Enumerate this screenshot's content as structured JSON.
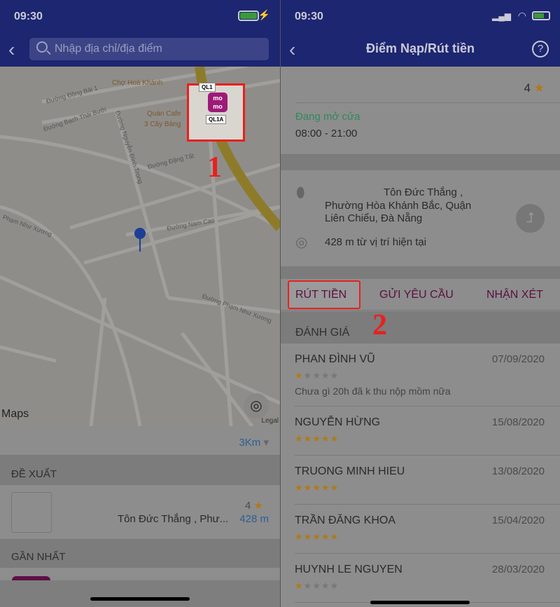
{
  "left": {
    "status": {
      "time": "09:30"
    },
    "search": {
      "placeholder": "Nhập địa chỉ/địa điểm"
    },
    "map": {
      "labels": [
        "Chợ Hoà Khánh",
        "Quán Cafe",
        "3 Cây Bàng",
        "Đường Đồng Bài 1",
        "Đường Bạch Thái Bưởi",
        "Đường Nguyễn Đình Trọng",
        "Đường Đặng Tất",
        "Đường Nam Cao",
        "Phạm Như Xương",
        "Đường Phạm Như Xương",
        "QL1",
        "QL1A"
      ],
      "attribution": "Maps",
      "legal": "Legal",
      "marker_text": "mo mo",
      "annotation": "1"
    },
    "radius": "3Km",
    "section_suggest": "ĐỀ XUẤT",
    "suggest_item": {
      "rating": "4",
      "address": "Tôn Đức Thắng  , Phư...",
      "distance": "428 m"
    },
    "section_nearest": "GẦN NHẤT"
  },
  "right": {
    "status": {
      "time": "09:30"
    },
    "nav_title": "Điểm Nạp/Rút tiền",
    "help": "?",
    "rating": "4",
    "open_status": "Đang mở cửa",
    "hours": "08:00 - 21:00",
    "address_line1": "Tôn Đức Thắng  ,",
    "address_line2": "Phường Hòa Khánh Bắc, Quận",
    "address_line3": "Liên Chiểu, Đà Nẵng",
    "distance": "428 m từ vị trí hiện tại",
    "tabs": [
      "RÚT TIỀN",
      "GỬI YÊU CẦU",
      "NHẬN XÉT"
    ],
    "annotation": "2",
    "section_reviews": "ĐÁNH GIÁ",
    "reviews": [
      {
        "name": "PHAN ĐÌNH VŨ",
        "date": "07/09/2020",
        "stars": 1,
        "comment": "Chưa gì 20h đã k thu nộp mồm nữa"
      },
      {
        "name": "NGUYỄN HỪNG",
        "date": "15/08/2020",
        "stars": 5
      },
      {
        "name": "TRUONG MINH HIEU",
        "date": "13/08/2020",
        "stars": 5
      },
      {
        "name": "TRẦN ĐĂNG KHOA",
        "date": "15/04/2020",
        "stars": 5
      },
      {
        "name": "HUYNH LE NGUYEN",
        "date": "28/03/2020",
        "stars": 1
      }
    ]
  },
  "colors": {
    "nav": "#1d2670",
    "accent": "#5a1040",
    "highlight": "#e8201e",
    "star": "#b07a15",
    "open": "#2e8a5e"
  }
}
